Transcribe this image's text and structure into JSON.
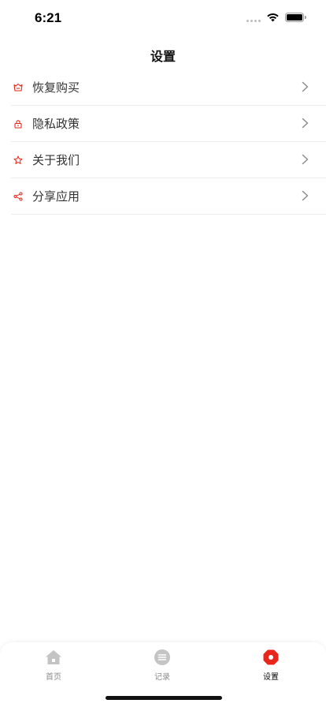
{
  "status_bar": {
    "time": "6:21"
  },
  "header": {
    "title": "设置"
  },
  "settings": {
    "items": [
      {
        "label": "恢复购买",
        "icon": "restore-basket-icon"
      },
      {
        "label": "隐私政策",
        "icon": "lock-icon"
      },
      {
        "label": "关于我们",
        "icon": "star-icon"
      },
      {
        "label": "分享应用",
        "icon": "share-icon"
      }
    ]
  },
  "tab_bar": {
    "tabs": [
      {
        "label": "首页",
        "icon": "home-icon",
        "active": false
      },
      {
        "label": "记录",
        "icon": "list-icon",
        "active": false
      },
      {
        "label": "设置",
        "icon": "settings-icon",
        "active": true
      }
    ]
  },
  "colors": {
    "accent": "#e8261c",
    "inactive_icon": "#c4c4c4",
    "divider": "#ececec"
  }
}
